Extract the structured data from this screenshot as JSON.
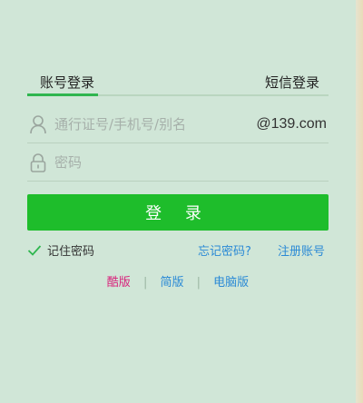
{
  "tabs": {
    "account_login": "账号登录",
    "sms_login": "短信登录"
  },
  "user_field": {
    "placeholder": "通行证号/手机号/别名",
    "domain": "@139.com"
  },
  "password_field": {
    "placeholder": "密码"
  },
  "login_button": "登 录",
  "remember": {
    "label": "记住密码",
    "checked": true
  },
  "links": {
    "forgot_password": "忘记密码?",
    "register": "注册账号"
  },
  "versions": {
    "cool": "酷版",
    "simple": "简版",
    "pc": "电脑版",
    "separator": "|"
  },
  "colors": {
    "background": "#d0e6d7",
    "accent_green": "#1ebd2b",
    "tab_underline": "#2fb64f",
    "link_blue": "#2b8ad6",
    "cool_version_pink": "#d8247c"
  }
}
